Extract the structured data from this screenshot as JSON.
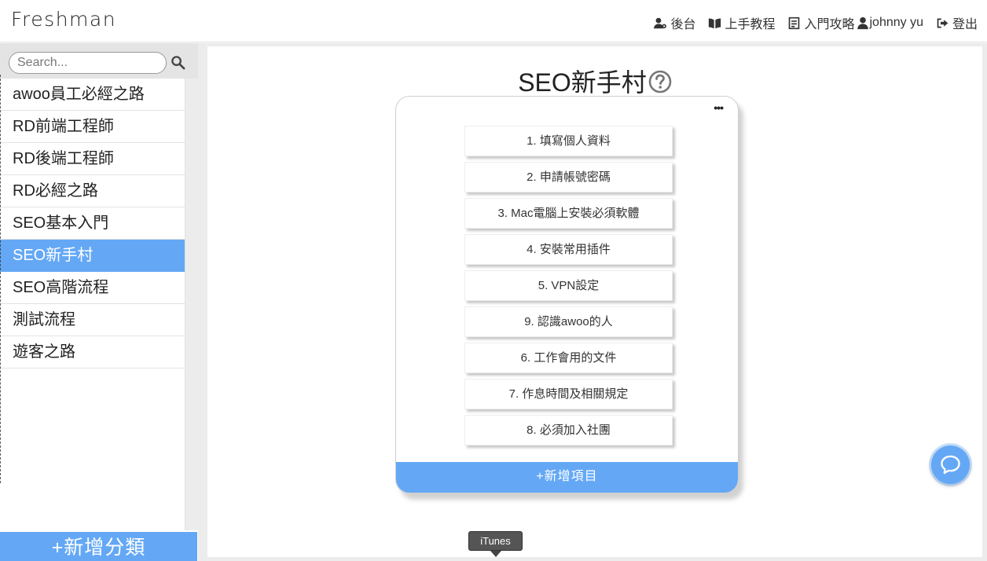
{
  "header": {
    "logo": "Freshman",
    "nav": {
      "admin": "後台",
      "tutorial": "上手教程",
      "guide": "入門攻略",
      "user": "johnny yu",
      "logout": "登出"
    }
  },
  "sidebar": {
    "search_placeholder": "Search...",
    "items": [
      {
        "label": "awoo員工必經之路"
      },
      {
        "label": "RD前端工程師"
      },
      {
        "label": "RD後端工程師"
      },
      {
        "label": "RD必經之路"
      },
      {
        "label": "SEO基本入門"
      },
      {
        "label": "SEO新手村"
      },
      {
        "label": "SEO高階流程"
      },
      {
        "label": "測試流程"
      },
      {
        "label": "遊客之路"
      }
    ],
    "active_index": 5,
    "add_label": "+新增分類"
  },
  "main": {
    "title": "SEO新手村",
    "more_label": "•••",
    "items": [
      {
        "label": "1. 填寫個人資料"
      },
      {
        "label": "2. 申請帳號密碼"
      },
      {
        "label": "3. Mac電腦上安裝必須軟體"
      },
      {
        "label": "4. 安裝常用插件"
      },
      {
        "label": "5. VPN設定"
      },
      {
        "label": "9. 認識awoo的人"
      },
      {
        "label": "6. 工作會用的文件"
      },
      {
        "label": "7. 作息時間及相關規定"
      },
      {
        "label": "8. 必須加入社團"
      }
    ],
    "add_label": "+新增項目"
  },
  "tooltip": {
    "text": "iTunes"
  },
  "colors": {
    "accent": "#64a8f5",
    "sidebar_bg": "#e4e4e4",
    "main_bg": "#ececec"
  }
}
